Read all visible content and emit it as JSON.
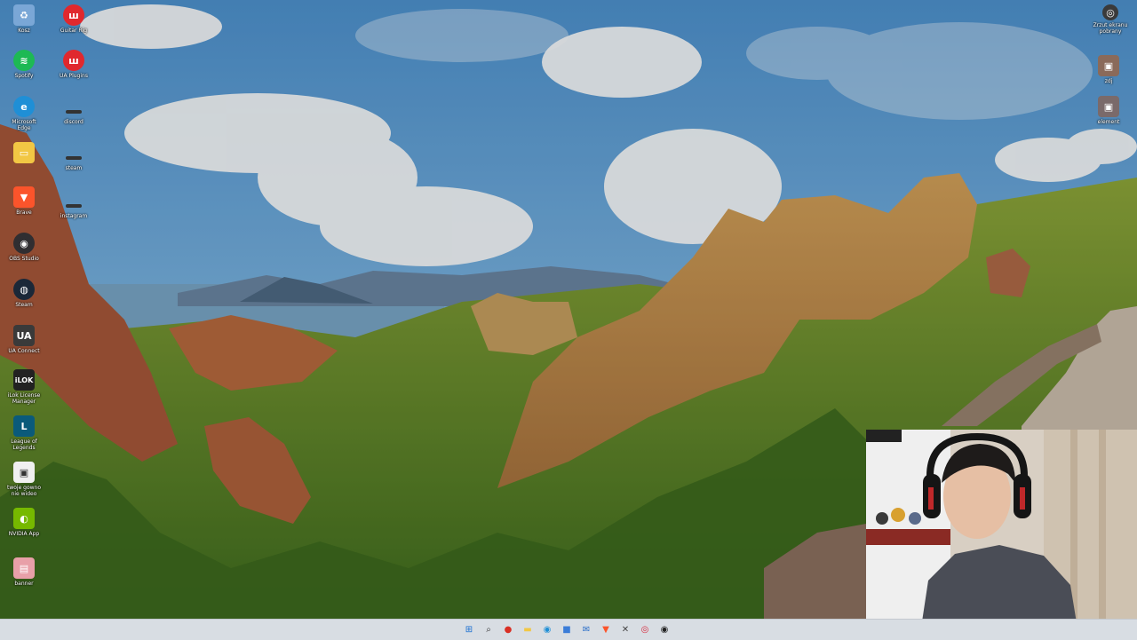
{
  "desktop": {
    "left_column": [
      {
        "label": "Kosz",
        "icon": "recycle-bin-icon",
        "color": "#7aa7d6"
      },
      {
        "label": "Spotify",
        "icon": "spotify-icon",
        "color": "#1db954"
      },
      {
        "label": "Microsoft Edge",
        "icon": "edge-icon",
        "color": "#1f8fd6"
      },
      {
        "label": "",
        "icon": "folder-icon",
        "color": "#f2c744"
      },
      {
        "label": "Brave",
        "icon": "brave-icon",
        "color": "#fb542b"
      },
      {
        "label": "OBS Studio",
        "icon": "obs-icon",
        "color": "#302e31"
      },
      {
        "label": "Steam",
        "icon": "steam-icon",
        "color": "#1b2838"
      },
      {
        "label": "UA Connect",
        "icon": "ua-connect-icon",
        "color": "#3a3a3a"
      },
      {
        "label": "iLok License Manager",
        "icon": "ilok-icon",
        "color": "#222222"
      },
      {
        "label": "League of Legends",
        "icon": "league-icon",
        "color": "#0a5a7a"
      },
      {
        "label": "twoje gowno nie wideo",
        "icon": "file-icon",
        "color": "#f0f0f0"
      },
      {
        "label": "NVIDIA App",
        "icon": "nvidia-icon",
        "color": "#76b900"
      },
      {
        "label": "banner",
        "icon": "image-file-icon",
        "color": "#e8a0a8"
      }
    ],
    "second_column": [
      {
        "label": "Guitar Rig",
        "icon": "app-red-icon",
        "color": "#e0282e"
      },
      {
        "label": "UA Plugins",
        "icon": "app-red-icon",
        "color": "#e0282e"
      },
      {
        "label": "discord",
        "icon": "shortcut-icon",
        "color": "#3a3a3a"
      },
      {
        "label": "steam",
        "icon": "shortcut-icon",
        "color": "#3a3a3a"
      },
      {
        "label": "instagram",
        "icon": "shortcut-icon",
        "color": "#3a3a3a"
      }
    ],
    "right_column": [
      {
        "label": "Zrzut ekranu pobrany",
        "icon": "screenshot-icon",
        "color": "#3a3a3a"
      },
      {
        "label": "zdj",
        "icon": "photo-icon",
        "color": "#8a6a5a"
      },
      {
        "label": "element",
        "icon": "photo-icon",
        "color": "#7a6a6a"
      }
    ]
  },
  "taskbar": {
    "icons": [
      {
        "name": "start-icon",
        "glyph": "⊞",
        "color": "#1a6fd1"
      },
      {
        "name": "search-icon",
        "glyph": "⌕",
        "color": "#333333"
      },
      {
        "name": "chrome-icon",
        "glyph": "●",
        "color": "#d93025"
      },
      {
        "name": "file-explorer-icon",
        "glyph": "▬",
        "color": "#f2c744"
      },
      {
        "name": "edge-icon",
        "glyph": "◉",
        "color": "#1f8fd6"
      },
      {
        "name": "store-icon",
        "glyph": "■",
        "color": "#3b7dd8"
      },
      {
        "name": "mail-icon",
        "glyph": "✉",
        "color": "#2a6ec8"
      },
      {
        "name": "brave-icon",
        "glyph": "▼",
        "color": "#fb542b"
      },
      {
        "name": "app-icon",
        "glyph": "✕",
        "color": "#444444"
      },
      {
        "name": "opera-icon",
        "glyph": "◎",
        "color": "#d6283c"
      },
      {
        "name": "record-icon",
        "glyph": "◉",
        "color": "#222222"
      }
    ]
  }
}
